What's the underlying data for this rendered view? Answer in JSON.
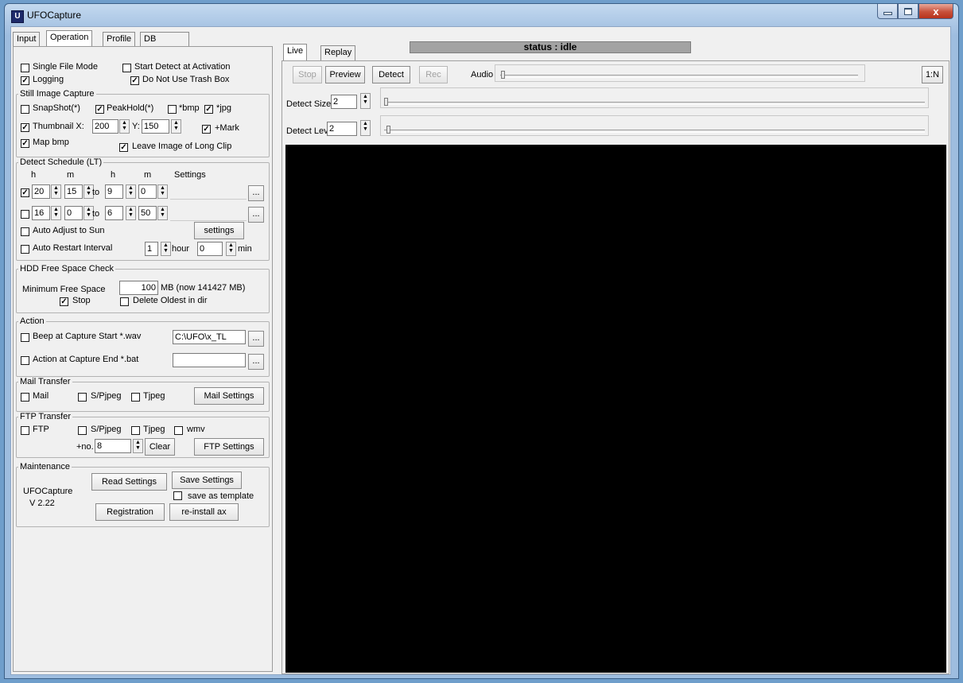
{
  "window": {
    "title": "UFOCapture",
    "close_glyph": "x"
  },
  "left_tabs": [
    "Input",
    "Operation",
    "Profile",
    "DB"
  ],
  "right_tabs": [
    "Live",
    "Replay"
  ],
  "status": "status : idle",
  "options": {
    "single_file_mode": "Single File Mode",
    "start_detect": "Start Detect at Activation",
    "logging": "Logging",
    "no_trash": "Do Not Use Trash Box"
  },
  "still": {
    "title": "Still Image Capture",
    "snapshot": "SnapShot(*)",
    "peakhold": "PeakHold(*)",
    "bmp": "*bmp",
    "jpg": "*jpg",
    "thumb_label": "Thumbnail X:",
    "thumb_x": "200",
    "y_label": "Y:",
    "thumb_y": "150",
    "mark": "+Mark",
    "map_bmp": "Map bmp",
    "leave_image": "Leave Image of Long Clip"
  },
  "schedule": {
    "title": "Detect Schedule (LT)",
    "h": "h",
    "m": "m",
    "settings": "Settings",
    "to": "to",
    "row1": {
      "h1": "20",
      "m1": "15",
      "h2": "9",
      "m2": "0"
    },
    "row2": {
      "h1": "16",
      "m1": "0",
      "h2": "6",
      "m2": "50"
    },
    "browse": "...",
    "auto_adjust": "Auto Adjust to Sun",
    "settings_btn": "settings",
    "auto_restart": "Auto Restart Interval",
    "restart_hour": "1",
    "hour_label": "hour",
    "restart_min": "0",
    "min_label": "min"
  },
  "hdd": {
    "title": "HDD Free Space Check",
    "min_label": "Minimum Free Space",
    "min_value": "100",
    "mb_text": "MB (now  141427 MB)",
    "stop": "Stop",
    "delete_oldest": "Delete Oldest in dir"
  },
  "action": {
    "title": "Action",
    "beep": "Beep at Capture Start *.wav",
    "beep_path": "C:\\UFO\\x_TL",
    "end": "Action at Capture End *.bat",
    "end_path": ""
  },
  "mail": {
    "title": "Mail Transfer",
    "mail": "Mail",
    "spjpeg": "S/Pjpeg",
    "tjpeg": "Tjpeg",
    "settings": "Mail Settings"
  },
  "ftp": {
    "title": "FTP Transfer",
    "ftp": "FTP",
    "spjpeg": "S/Pjpeg",
    "tjpeg": "Tjpeg",
    "wmv": "wmv",
    "no_label": "+no.",
    "no_value": "8",
    "clear": "Clear",
    "settings": "FTP Settings"
  },
  "maintenance": {
    "title": "Maintenance",
    "app": "UFOCapture",
    "version": "V  2.22",
    "read": "Read Settings",
    "save": "Save Settings",
    "template": "save as template",
    "registration": "Registration",
    "reinstall": "re-install ax"
  },
  "toolbar": {
    "stop": "Stop",
    "preview": "Preview",
    "detect": "Detect",
    "rec": "Rec",
    "audio": "Audio",
    "ratio": "1:N"
  },
  "detect": {
    "size_label": "Detect Size",
    "size_value": "2",
    "lev_label": "Detect Lev",
    "lev_value": "2"
  }
}
